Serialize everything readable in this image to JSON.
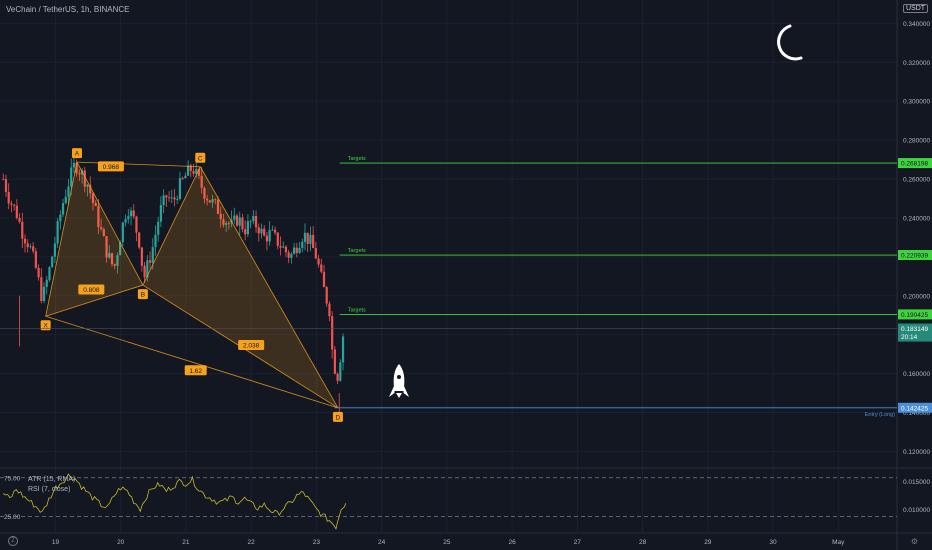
{
  "header": {
    "symbol_title": "VeChain / TetherUS, 1h, BINANCE",
    "currency": "USDT"
  },
  "indicators": {
    "atr_label": "ATR (15, RMA)",
    "rsi_label": "RSI (7, close)",
    "rsi_levels": [
      "75.00",
      "25.00"
    ],
    "atr_ticks": [
      "0.015000",
      "0.010000"
    ]
  },
  "colors": {
    "background": "#131722",
    "up_candle": "#26a69a",
    "down_candle": "#ef5350",
    "pattern": "#f7a21b",
    "target_line": "#3fd43f",
    "entry_line": "#4b8fdb",
    "rsi_line": "#c9b928",
    "current_price_badge": "#268a7a"
  },
  "chart_data": {
    "type": "candlestick",
    "y_axis": {
      "ticks": [
        "0.340000",
        "0.320000",
        "0.300000",
        "0.280000",
        "0.260000",
        "0.240000",
        "0.220000",
        "0.200000",
        "0.180000",
        "0.160000",
        "0.140000",
        "0.120000"
      ],
      "ylim": [
        0.112,
        0.352
      ]
    },
    "x_axis": {
      "ticks": [
        "19",
        "20",
        "21",
        "22",
        "23",
        "24",
        "25",
        "26",
        "27",
        "28",
        "29",
        "30",
        "May"
      ],
      "tick_values": [
        19,
        20,
        21,
        22,
        23,
        24,
        25,
        26,
        27,
        28,
        29,
        30,
        31
      ],
      "xlim": [
        18.15,
        31.9
      ]
    },
    "price_series": [
      [
        18.2,
        0.26
      ],
      [
        18.3,
        0.249
      ],
      [
        18.4,
        0.243
      ],
      [
        18.5,
        0.232
      ],
      [
        18.6,
        0.226
      ],
      [
        18.7,
        0.214
      ],
      [
        18.8,
        0.198
      ],
      [
        18.9,
        0.212
      ],
      [
        19.0,
        0.229
      ],
      [
        19.1,
        0.246
      ],
      [
        19.2,
        0.258
      ],
      [
        19.3,
        0.268
      ],
      [
        19.4,
        0.263
      ],
      [
        19.5,
        0.257
      ],
      [
        19.6,
        0.245
      ],
      [
        19.7,
        0.233
      ],
      [
        19.8,
        0.221
      ],
      [
        19.9,
        0.214
      ],
      [
        20.0,
        0.232
      ],
      [
        20.1,
        0.246
      ],
      [
        20.2,
        0.239
      ],
      [
        20.3,
        0.226
      ],
      [
        20.35,
        0.208
      ],
      [
        20.5,
        0.226
      ],
      [
        20.6,
        0.243
      ],
      [
        20.7,
        0.251
      ],
      [
        20.8,
        0.248
      ],
      [
        20.9,
        0.256
      ],
      [
        21.0,
        0.262
      ],
      [
        21.1,
        0.266
      ],
      [
        21.2,
        0.259
      ],
      [
        21.3,
        0.252
      ],
      [
        21.4,
        0.248
      ],
      [
        21.5,
        0.244
      ],
      [
        21.6,
        0.239
      ],
      [
        21.7,
        0.236
      ],
      [
        21.8,
        0.24
      ],
      [
        21.9,
        0.234
      ],
      [
        22.0,
        0.238
      ],
      [
        22.1,
        0.236
      ],
      [
        22.2,
        0.23
      ],
      [
        22.3,
        0.232
      ],
      [
        22.4,
        0.228
      ],
      [
        22.5,
        0.224
      ],
      [
        22.6,
        0.22
      ],
      [
        22.7,
        0.226
      ],
      [
        22.8,
        0.232
      ],
      [
        22.9,
        0.228
      ],
      [
        23.0,
        0.22
      ],
      [
        23.1,
        0.205
      ],
      [
        23.2,
        0.193
      ],
      [
        23.25,
        0.168
      ],
      [
        23.32,
        0.158
      ],
      [
        23.38,
        0.172
      ],
      [
        23.42,
        0.183
      ]
    ],
    "rsi_series": [
      [
        18.2,
        55
      ],
      [
        18.3,
        48
      ],
      [
        18.4,
        60
      ],
      [
        18.5,
        52
      ],
      [
        18.6,
        45
      ],
      [
        18.7,
        38
      ],
      [
        18.8,
        30
      ],
      [
        18.9,
        47
      ],
      [
        19.0,
        62
      ],
      [
        19.1,
        70
      ],
      [
        19.2,
        78
      ],
      [
        19.3,
        74
      ],
      [
        19.4,
        64
      ],
      [
        19.5,
        55
      ],
      [
        19.6,
        47
      ],
      [
        19.7,
        40
      ],
      [
        19.8,
        36
      ],
      [
        19.9,
        52
      ],
      [
        20.0,
        62
      ],
      [
        20.1,
        58
      ],
      [
        20.2,
        45
      ],
      [
        20.3,
        35
      ],
      [
        20.4,
        52
      ],
      [
        20.5,
        63
      ],
      [
        20.6,
        66
      ],
      [
        20.7,
        58
      ],
      [
        20.8,
        64
      ],
      [
        20.9,
        70
      ],
      [
        21.0,
        68
      ],
      [
        21.1,
        72
      ],
      [
        21.2,
        60
      ],
      [
        21.3,
        52
      ],
      [
        21.4,
        48
      ],
      [
        21.5,
        43
      ],
      [
        21.6,
        45
      ],
      [
        21.7,
        50
      ],
      [
        21.8,
        44
      ],
      [
        21.9,
        48
      ],
      [
        22.0,
        41
      ],
      [
        22.1,
        36
      ],
      [
        22.2,
        40
      ],
      [
        22.3,
        33
      ],
      [
        22.4,
        28
      ],
      [
        22.5,
        36
      ],
      [
        22.6,
        42
      ],
      [
        22.7,
        52
      ],
      [
        22.8,
        56
      ],
      [
        22.9,
        45
      ],
      [
        23.0,
        34
      ],
      [
        23.1,
        26
      ],
      [
        23.2,
        20
      ],
      [
        23.3,
        12
      ],
      [
        23.38,
        36
      ],
      [
        23.45,
        42
      ]
    ],
    "harmonic_pattern": {
      "points": [
        {
          "label": "X",
          "x": 18.85,
          "y": 0.1895
        },
        {
          "label": "A",
          "x": 19.33,
          "y": 0.2687
        },
        {
          "label": "B",
          "x": 20.34,
          "y": 0.2055
        },
        {
          "label": "C",
          "x": 21.22,
          "y": 0.2663
        },
        {
          "label": "D",
          "x": 23.33,
          "y": 0.1424
        }
      ],
      "ratios": [
        {
          "label": "0.968",
          "x": 19.85,
          "y": 0.2665
        },
        {
          "label": "0.808",
          "x": 19.55,
          "y": 0.2032
        },
        {
          "label": "1.62",
          "x": 21.15,
          "y": 0.1617
        },
        {
          "label": "2.038",
          "x": 22.0,
          "y": 0.1747
        }
      ]
    },
    "targets": [
      {
        "label": "Targets",
        "price": 0.268198,
        "price_label": "0.268198"
      },
      {
        "label": "Targets",
        "price": 0.220939,
        "price_label": "0.220939"
      },
      {
        "label": "Targets",
        "price": 0.190425,
        "price_label": "0.190425"
      }
    ],
    "entry": {
      "label": "Entry (Long)",
      "price": 0.142425,
      "price_label": "0.142425"
    },
    "current_price": {
      "price": 0.183149,
      "price_label": "0.183149",
      "countdown": "20:14"
    },
    "target_line_start_x": 23.45
  }
}
